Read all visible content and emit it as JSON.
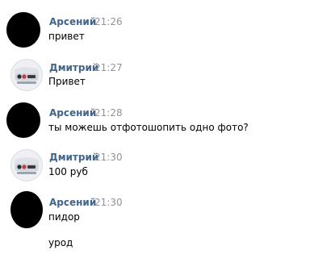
{
  "messages": [
    {
      "author": "Арсений",
      "time": "21:26",
      "lines": [
        "привет"
      ],
      "avatar": "black-circle-avatar"
    },
    {
      "author": "Дмитрий",
      "time": "21:27",
      "lines": [
        "Привет"
      ],
      "avatar": "car-photo-avatar"
    },
    {
      "author": "Арсений",
      "time": "21:28",
      "lines": [
        "ты можешь отфотошопить одно фото?"
      ],
      "avatar": "black-circle-avatar"
    },
    {
      "author": "Дмитрий",
      "time": "21:30",
      "lines": [
        "100 руб"
      ],
      "avatar": "car-photo-avatar"
    },
    {
      "author": "Арсений",
      "time": "21:30",
      "lines": [
        "пидор",
        "урод"
      ],
      "avatar": "black-circle-avatar"
    }
  ],
  "colors": {
    "author": "#42648b",
    "time": "#939393",
    "text": "#000000",
    "background": "#ffffff"
  }
}
